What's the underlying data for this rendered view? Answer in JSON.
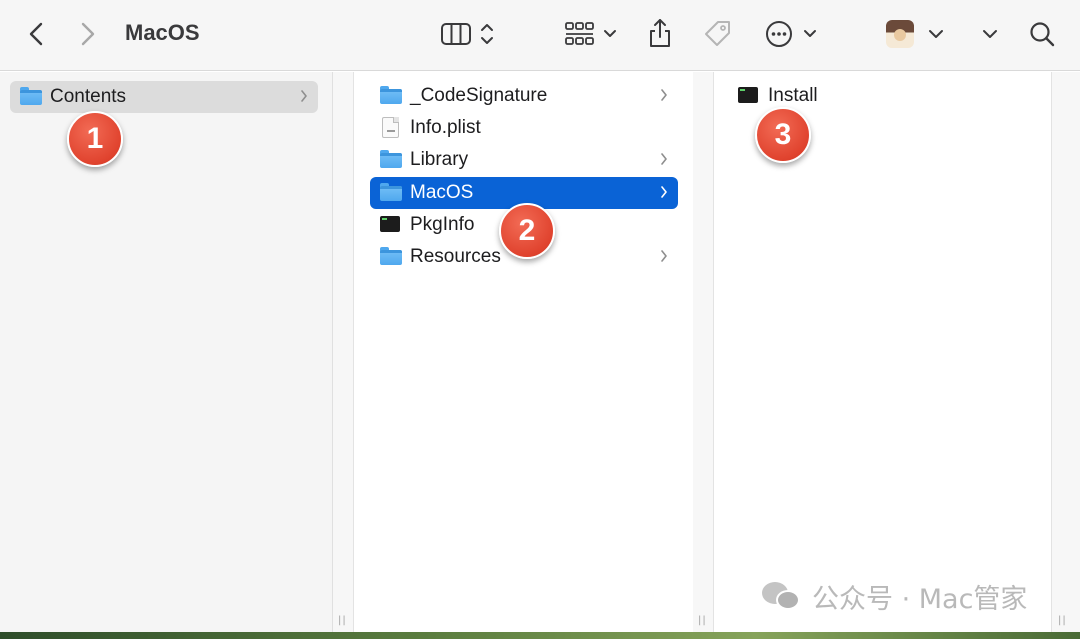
{
  "window": {
    "title": "MacOS"
  },
  "toolbar": {
    "back_icon": "chevron-left-icon",
    "forward_icon": "chevron-right-icon",
    "view_icon": "column-view-icon",
    "group_icon": "grid-group-icon",
    "share_icon": "share-icon",
    "tag_icon": "tag-icon",
    "more_icon": "ellipsis-circle-icon",
    "search_icon": "search-icon"
  },
  "columns": {
    "col1": {
      "items": [
        {
          "label": "Contents",
          "kind": "folder",
          "has_children": true,
          "selected": true
        }
      ]
    },
    "col2": {
      "items": [
        {
          "label": "_CodeSignature",
          "kind": "folder",
          "has_children": true
        },
        {
          "label": "Info.plist",
          "kind": "plist",
          "has_children": false
        },
        {
          "label": "Library",
          "kind": "folder",
          "has_children": true
        },
        {
          "label": "MacOS",
          "kind": "folder",
          "has_children": true,
          "selected": true
        },
        {
          "label": "PkgInfo",
          "kind": "exec",
          "has_children": false
        },
        {
          "label": "Resources",
          "kind": "folder",
          "has_children": true
        }
      ]
    },
    "col3": {
      "items": [
        {
          "label": "Install",
          "kind": "exec",
          "has_children": false
        }
      ]
    }
  },
  "markers": [
    {
      "label": "1"
    },
    {
      "label": "2"
    },
    {
      "label": "3"
    }
  ],
  "resize_handle": "||",
  "watermark": {
    "text": "公众号 · Mac管家"
  },
  "colors": {
    "selection_blue": "#0a63d6",
    "selection_gray": "#dcdcdc",
    "folder_blue": "#4fa8ee",
    "marker_red": "#e0432e"
  }
}
